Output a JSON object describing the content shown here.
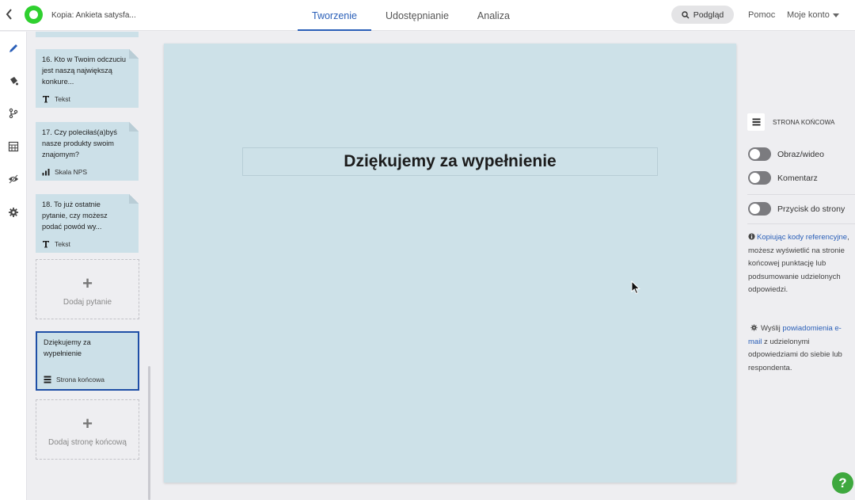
{
  "header": {
    "doc_title": "Kopia: Ankieta satysfa...",
    "tabs": [
      {
        "label": "Tworzenie",
        "active": true
      },
      {
        "label": "Udostępnianie",
        "active": false
      },
      {
        "label": "Analiza",
        "active": false
      }
    ],
    "preview_label": "Podgląd",
    "help_label": "Pomoc",
    "account_label": "Moje konto"
  },
  "rail": {
    "items": [
      "pencil-icon",
      "paint-bucket-icon",
      "branch-icon",
      "calculator-icon",
      "eye-slash-icon",
      "gear-icon"
    ],
    "active_index": 0
  },
  "questions": [
    {
      "text": "16. Kto w Twoim odczuciu jest naszą największą konkure...",
      "type": "Tekst",
      "icon": "text-type-icon"
    },
    {
      "text": "17. Czy poleciłaś(a)byś nasze produkty swoim znajomym?",
      "type": "Skala NPS",
      "icon": "nps-scale-icon"
    },
    {
      "text": "18. To już ostatnie pytanie, czy możesz podać powód wy...",
      "type": "Tekst",
      "icon": "text-type-icon"
    }
  ],
  "add_question_label": "Dodaj pytanie",
  "end_page_card": {
    "text": "Dziękujemy za wypełnienie",
    "type": "Strona końcowa"
  },
  "add_end_page_label": "Dodaj stronę końcową",
  "canvas": {
    "heading": "Dziękujemy za wypełnienie"
  },
  "right_panel": {
    "section_title": "STRONA KOŃCOWA",
    "toggles": [
      {
        "label": "Obraz/wideo",
        "on": false
      },
      {
        "label": "Komentarz",
        "on": false
      },
      {
        "label": "Przycisk do strony",
        "on": false
      }
    ],
    "info1_link": "Kopiując kody referencyjne",
    "info1_text": ", możesz wyświetlić na stronie końcowej punktację lub podsumowanie udzielonych odpowiedzi.",
    "info2_prefix": "Wyślij ",
    "info2_link": "powiadomienia e-mail",
    "info2_text": " z udzielonymi odpowiedziami do siebie lub respondenta."
  },
  "colors": {
    "accent": "#2a5fb8",
    "brand_green": "#2fd02f",
    "canvas_bg": "#cde1e8",
    "card_bg": "#cce0e8"
  }
}
